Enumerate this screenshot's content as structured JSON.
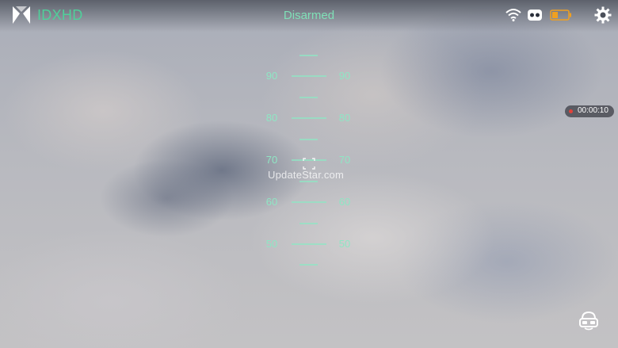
{
  "header": {
    "brand": "IDXHD",
    "status": "Disarmed",
    "icons": [
      "drone-logo-icon",
      "wifi-icon",
      "robot-icon",
      "battery-icon",
      "gear-icon"
    ]
  },
  "pitch_ladder": {
    "labels": [
      {
        "value": "90"
      },
      {
        "value": "80"
      },
      {
        "value": "70"
      },
      {
        "value": "60"
      },
      {
        "value": "50"
      }
    ]
  },
  "watermark": "UpdateStar.com",
  "recording": {
    "time": "00:00:10"
  },
  "colors": {
    "accent": "#4fd09a",
    "ladder": "#8fe6c4",
    "record": "#e0433b",
    "battery": "#f0a020"
  }
}
